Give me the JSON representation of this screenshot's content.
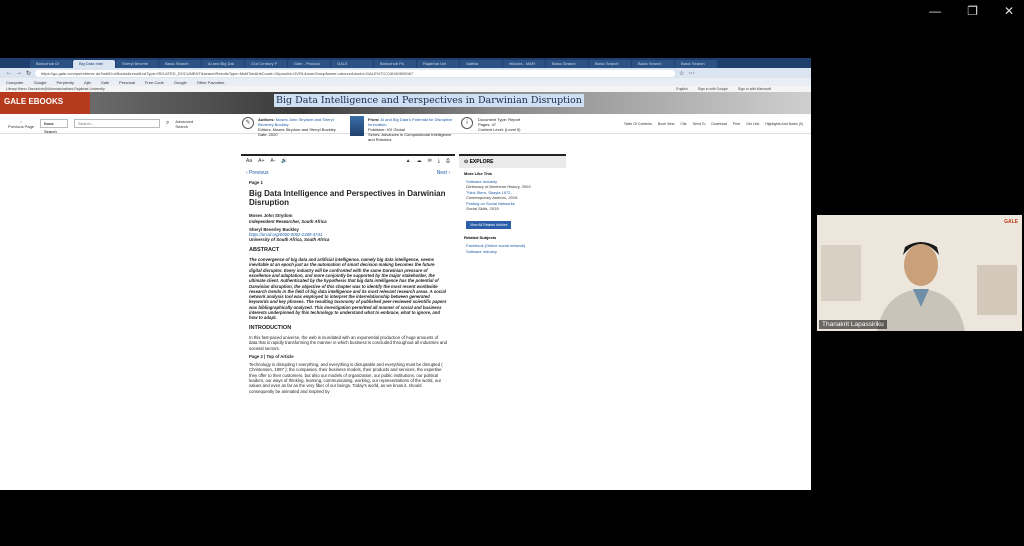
{
  "window": {
    "minimize": "—",
    "maximize": "❐",
    "close": "✕"
  },
  "browser": {
    "tabs": [
      "Banuchob Gr",
      "Big Data Intel",
      "Sheryl Beverle",
      "Basic Search",
      "AI and Big Dat",
      "21st Century F",
      "Gale - Product",
      "GALE",
      "Banuchob Po",
      "Rajabhat Uni",
      "Sathila",
      "eBooks - MAFI",
      "Basic Search",
      "Basic Search",
      "Basic Search",
      "Basic Search"
    ],
    "url": "https://go.gale.com/ps/retrieve.do?tabID=eBooks&resultListType=RELATED_DOCUMENT&searchResultsType=MultiTab&hitCount=2&prodId=GVRL&userGroupName=ubonru&docId=GALE%7CCX8160500067",
    "bookmarks": [
      "Computer",
      "Google",
      "Perplexity",
      "Ajib",
      "Gale",
      "Personal",
      "Free Code",
      "Google",
      "Other Favorites"
    ],
    "info_left": "Library Menu: Banuchob@Ubonratchathani Rajabhat University",
    "info_right": [
      "English",
      "Sign in with Google",
      "Sign in with Microsoft"
    ]
  },
  "gale": {
    "logo": "GALE EBOOKS",
    "prev_page": "Previous Page",
    "basic_search": "Basic Search",
    "search_placeholder": "Search...",
    "advanced": "Advanced Search",
    "tools": [
      "Table Of Contents",
      "Book View",
      "Cite",
      "Send To",
      "Download",
      "Print",
      "Get Link",
      "Highlights And Notes (0)"
    ]
  },
  "doc": {
    "title": "Big Data Intelligence and Perspectives in Darwinian Disruption",
    "authors_label": "Authors:",
    "authors": "Moses John Strydom and Sheryl Beverley Buckley",
    "editors": "Editors: Moses Strydom and Sheryl Buckley",
    "date": "Date: 2020",
    "from_label": "From:",
    "from": "AI and Big Data's Potential for Disruptive Innovation",
    "publisher": "Publisher: IGI Global",
    "series": "Series: Advances in Computational Intelligence and Robotics",
    "doc_type": "Document Type: Report",
    "pages": "Pages: 47",
    "content_level": "Content Level: (Level 5)"
  },
  "article": {
    "tools": [
      "Aa",
      "A+",
      "A-",
      "Listen"
    ],
    "previous": "Previous",
    "next": "Next",
    "page1": "Page 1",
    "heading": "Big Data Intelligence and Perspectives in Darwinian Disruption",
    "author1": "Moses John Strydom",
    "aff1": "Independent Researcher, South Africa",
    "author2": "Sheryl Beverley Buckley",
    "orcid": "https://orcid.org/0000-0002-2369-4741",
    "aff2": "University of South Africa, South Africa",
    "abstract_h": "ABSTRACT",
    "abstract": "The convergence of big data and artificial intelligence, namely big data intelligence, seems inevitable at an epoch just as the automation of smart decision making becomes the future digital disruptor. Every industry will be confronted with the same Darwinian pressure of excellence and adaptation, and more conjointly be supported by the major stakeholder, the ultimate client. Authenticated by the hypothesis that big data intelligence has the potential of Darwinian disruption, the objective of this chapter was to identify the most recent worldwide research trends in the field of big data intelligence and its most relevant research areas. A social network analysis tool was employed to interpret the interrelationship between generated keywords and key phrases. The resulting taxonomy of published peer-reviewed scientific papers was bibliographically analyzed. This investigation permitted all manner of social and business interests underpinned by this technology to understand what to embrace, what to ignore, and how to adapt.",
    "intro_h": "INTRODUCTION",
    "intro": "In this fast-paced universe, the web is inundated with an exponential production of huge amounts of data that is rapidly transforming the manner in which business is concluded throughout all industries and societal sectors.",
    "page2": "Page 2 | Top of Article",
    "p2": "Technology is disrupting t everything, and everything is disruptable and everything must be disrupted ( Christensen, 1997 ); the companies, their business models, their products and services, the expertise they offer to their customers, but also our models of organization, our public institutions, our political leaders, our ways of thinking, learning, communicating, working, our representations of the world, our values and even as far as the very fiber of our beings. Today's world, as we know it, should consequently be animated and inspired by"
  },
  "explore": {
    "title": "EXPLORE",
    "more_like": "More Like This",
    "items": [
      {
        "title": "Software Industry",
        "sub": "Dictionary of American History, 2003."
      },
      {
        "title": "Third-Stern, Shayla 1972-",
        "sub": "Contemporary Authors, 2016."
      },
      {
        "title": "Posting on Social Networks",
        "sub": "Social Skills, 2019."
      }
    ],
    "view_all": "View All Related Articles",
    "related_subjects": "Related Subjects",
    "subjects": [
      "Facebook (Online social network)",
      "Software industry"
    ]
  },
  "webcam": {
    "name": "Thanakrit Lapassiriku",
    "logo": "GALE"
  }
}
